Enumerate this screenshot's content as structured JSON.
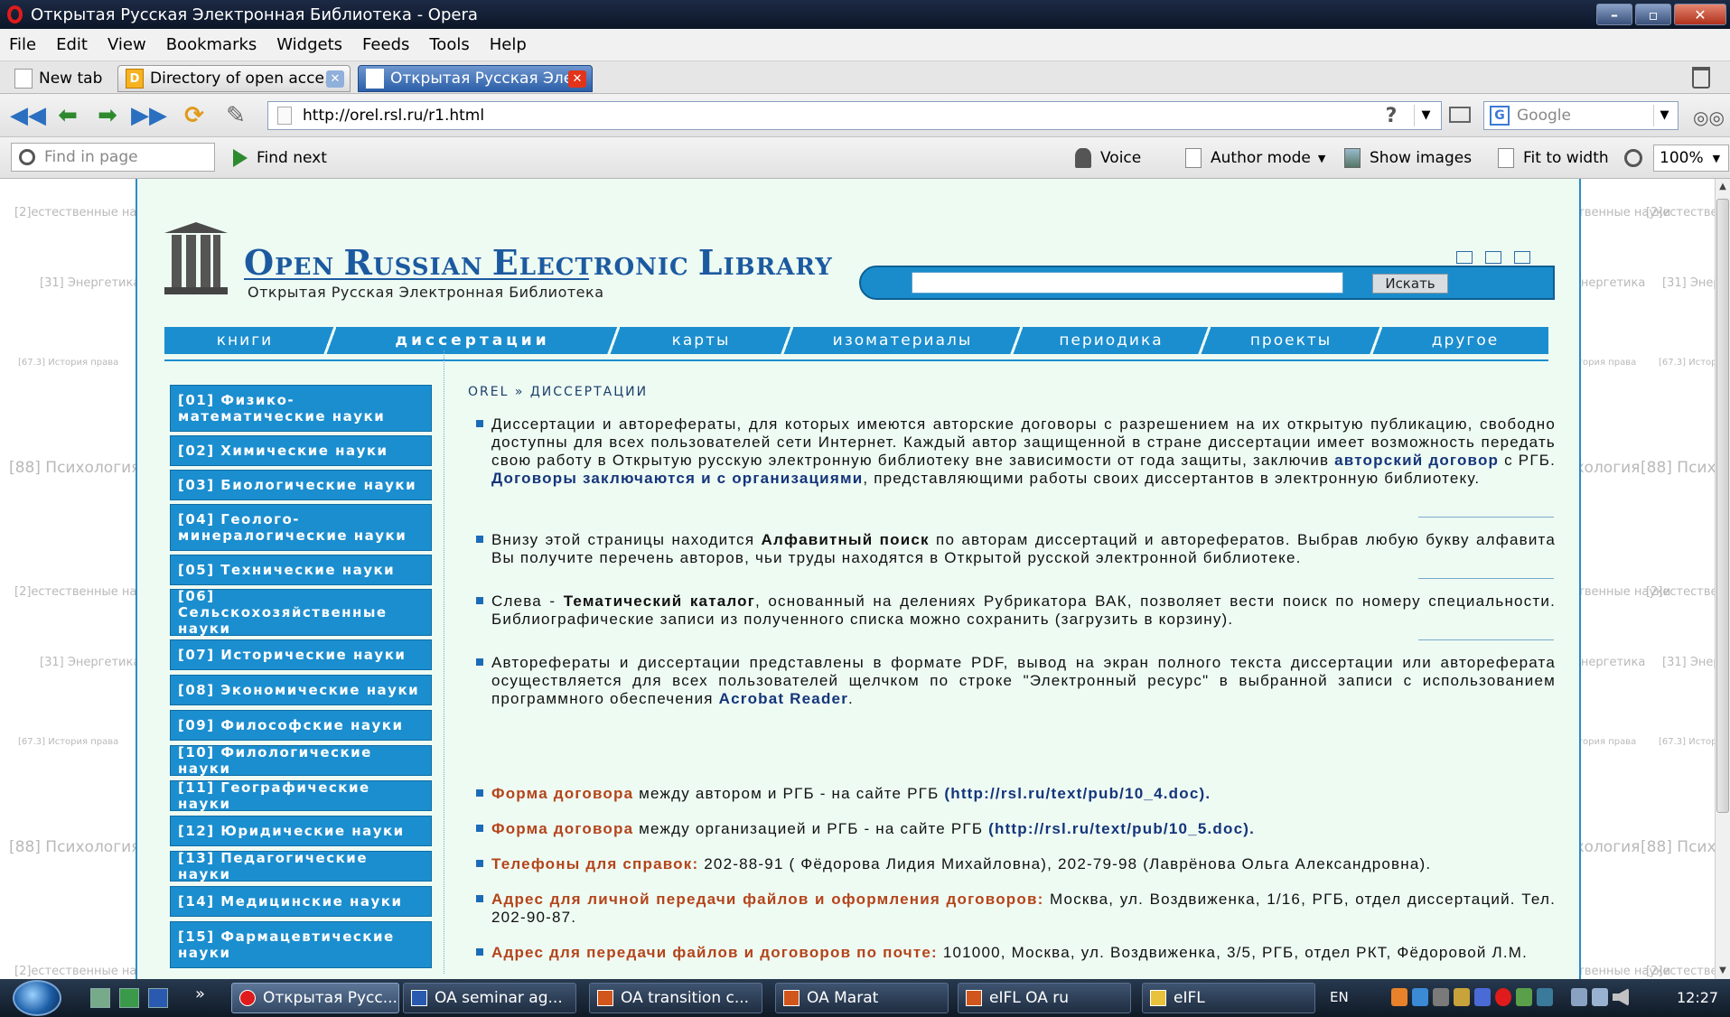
{
  "window": {
    "title": "Открытая Русская Электронная Библиотека - Opera"
  },
  "menu": [
    "File",
    "Edit",
    "View",
    "Bookmarks",
    "Widgets",
    "Feeds",
    "Tools",
    "Help"
  ],
  "tabs": {
    "new_tab": "New tab",
    "items": [
      {
        "label": "Directory of open acce...",
        "active": false
      },
      {
        "label": "Открытая Русская Эле...",
        "active": true
      }
    ]
  },
  "address": {
    "url": "http://orel.rsl.ru/r1.html",
    "search_placeholder": "Google"
  },
  "findbar": {
    "find_placeholder": "Find in page",
    "find_next": "Find next",
    "voice": "Voice",
    "author_mode": "Author mode",
    "show_images": "Show images",
    "fit_to_width": "Fit to width",
    "zoom": "100%"
  },
  "gutter": {
    "t1": "[2]естественные науки",
    "t2": "[31] Энергетика",
    "t3": "[67.3] История права",
    "t4": "[88] Психология"
  },
  "site": {
    "logo_title": {
      "o": "O",
      "pen": "PEN",
      "r": "R",
      "ussian": "USSIAN",
      "e": "E",
      "lectronic": "LECTRONIC",
      "l": "L",
      "ibrary": "IBRARY"
    },
    "logo_subtitle": "Открытая Русская Электронная Библиотека",
    "search_button": "Искать",
    "nav": [
      {
        "label": "книги",
        "active": false
      },
      {
        "label": "диссертации",
        "active": true
      },
      {
        "label": "карты",
        "active": false
      },
      {
        "label": "изоматериалы",
        "active": false
      },
      {
        "label": "периодика",
        "active": false
      },
      {
        "label": "проекты",
        "active": false
      },
      {
        "label": "другое",
        "active": false
      }
    ],
    "catalog": [
      "[01] Физико-математические науки",
      "[02] Химические науки",
      "[03] Биологические науки",
      "[04] Геолого-минералогические науки",
      "[05] Технические науки",
      "[06] Сельскохозяйственные науки",
      "[07] Исторические науки",
      "[08] Экономические науки",
      "[09] Философские науки",
      "[10] Филологические науки",
      "[11] Географические науки",
      "[12] Юридические науки",
      "[13] Педагогические науки",
      "[14] Медицинские науки",
      "[15] Фармацевтические науки"
    ],
    "breadcrumb": "OREL » ДИССЕРТАЦИИ",
    "p1": {
      "a": "Диссертации и авторефераты, для которых имеются авторские договоры с разрешением на их открытую публикацию, свободно доступны для всех пользователей сети Интернет. Каждый автор защищенной в стране диссертации имеет возможность передать свою работу в Открытую русскую электронную библиотеку вне зависимости от года защиты, заключив ",
      "link1": "авторский договор",
      "b": " с РГБ. ",
      "link2": "Договоры заключаются и с организациями",
      "c": ", представляющими работы своих диссертантов в электронную библиотеку."
    },
    "p2": {
      "a": "Внизу этой страницы находится ",
      "strong": "Алфавитный поиск",
      "b": " по авторам диссертаций и авторефератов. Выбрав любую букву алфавита Вы получите перечень авторов, чьи труды находятся в Открытой русской электронной библиотеке."
    },
    "p3": {
      "a": "Слева - ",
      "strong": "Тематический каталог",
      "b": ", основанный на делениях Рубрикатора ВАК, позволяет вести поиск по номеру специальности. Библиографические записи из полученного списка можно сохранить (загрузить в корзину)."
    },
    "p4": {
      "a": "Авторефераты и диссертации представлены в формате PDF, вывод на экран полного текста диссертации или автореферата осуществляется для всех пользователей щелчком по строке \"Электронный ресурс\" в выбранной записи с использованием программного обеспечения ",
      "link": "Acrobat Reader",
      "b": "."
    },
    "p5": {
      "orange": "Форма договора",
      "text": " между автором и РГБ - на сайте РГБ ",
      "link": "(http://rsl.ru/text/pub/10_4.doc)."
    },
    "p6": {
      "orange": "Форма договора",
      "text": " между организацией и РГБ - на сайте РГБ ",
      "link": "(http://rsl.ru/text/pub/10_5.doc)."
    },
    "p7": {
      "orange": "Телефоны для справок:",
      "text": " 202-88-91 ( Фёдорова Лидия Михайловна), 202-79-98 (Лаврёнова Ольга Александровна)."
    },
    "p8": {
      "orange": "Адрес для личной передачи файлов и оформления договоров:",
      "text": " Москва, ул. Воздвиженка, 1/16, РГБ, отдел диссертаций. Тел. 202-90-87."
    },
    "p9": {
      "orange": "Адрес для передачи файлов и договоров по почте:",
      "text": " 101000, Москва, ул. Воздвиженка, 3/5, РГБ, отдел РКТ, Фёдоровой Л.М."
    }
  },
  "taskbar": {
    "tasks": [
      "Открытая Русс...",
      "OA seminar ag...",
      "OA transition c...",
      "OA Marat",
      "eIFL OA ru",
      "eIFL"
    ],
    "lang": "EN",
    "clock": "12:27"
  },
  "colors": {
    "accent": "#1b8ecf",
    "page_bg": "#eefbf3",
    "link": "#14357a",
    "orange_label": "#b4441a"
  }
}
